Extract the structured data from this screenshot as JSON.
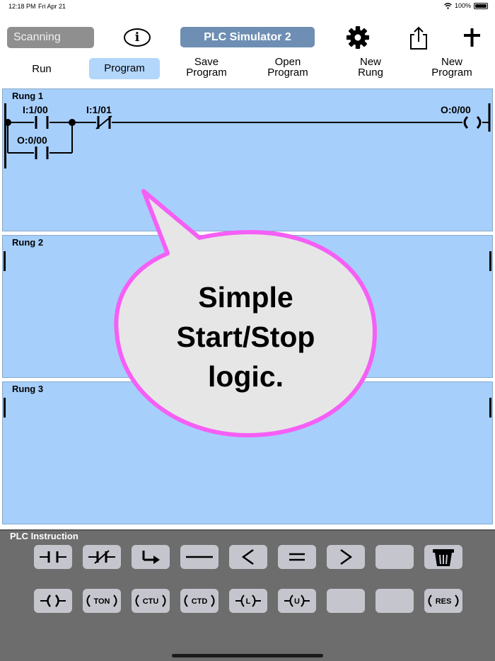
{
  "status": {
    "time": "12:18 PM",
    "date": "Fri Apr 21",
    "battery": "100%"
  },
  "toolbar": {
    "scan_label": "Scanning",
    "info_label": "i",
    "title": "PLC Simulator 2",
    "icons": [
      "gear-icon",
      "share-icon",
      "plus-icon"
    ]
  },
  "menu": {
    "run": "Run",
    "program": "Program",
    "save_program": [
      "Save",
      "Program"
    ],
    "open_program": [
      "Open",
      "Program"
    ],
    "new_rung": [
      "New",
      "Rung"
    ],
    "new_program": [
      "New",
      "Program"
    ]
  },
  "rungs": [
    {
      "label": "Rung 1",
      "contacts": [
        {
          "address": "I:1/00",
          "type": "NO"
        },
        {
          "address": "I:1/01",
          "type": "NC"
        },
        {
          "address": "O:0/00",
          "type": "NO-branch"
        }
      ],
      "coil": {
        "address": "O:0/00"
      }
    },
    {
      "label": "Rung 2"
    },
    {
      "label": "Rung 3"
    }
  ],
  "callout": {
    "lines": [
      "Simple",
      "Start/Stop",
      "logic."
    ],
    "border_color": "#f55ff5",
    "fill_color": "#e6e6e6"
  },
  "panel": {
    "title": "PLC Instruction",
    "row1": [
      "-| |-",
      "-|/|-",
      "branch",
      "—",
      "<",
      "=",
      ">",
      "",
      "trash-icon"
    ],
    "row2": [
      "-( )-",
      "TON",
      "CTU",
      "CTD",
      "-(L)-",
      "-(U)-",
      "",
      "",
      "RES"
    ]
  },
  "colors": {
    "rung_bg": "#a7cffc",
    "accent": "#6e8fb3",
    "panel_bg": "#6d6d6d",
    "button_bg": "#c5c5ce"
  }
}
